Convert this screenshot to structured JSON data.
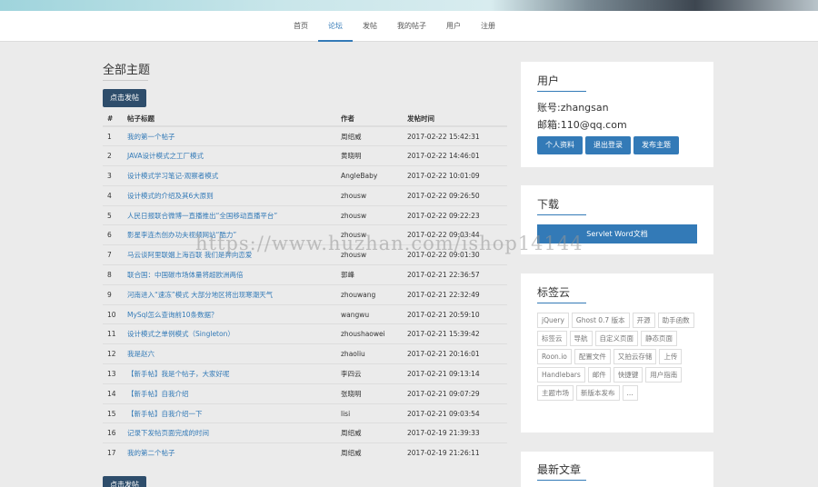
{
  "nav": {
    "items": [
      {
        "label": "首页"
      },
      {
        "label": "论坛"
      },
      {
        "label": "发帖"
      },
      {
        "label": "我的帖子"
      },
      {
        "label": "用户"
      },
      {
        "label": "注册"
      }
    ],
    "active": "论坛",
    "accent_color": "#337ab7"
  },
  "main": {
    "title": "全部主题",
    "post_button": "点击发帖",
    "columns": [
      "#",
      "帖子标题",
      "作者",
      "发帖时间"
    ],
    "rows": [
      {
        "num": "1",
        "title": "我的第一个帖子",
        "author": "周绍威",
        "time": "2017-02-22 15:42:31"
      },
      {
        "num": "2",
        "title": "JAVA设计模式之工厂模式",
        "author": "黄晓明",
        "time": "2017-02-22 14:46:01"
      },
      {
        "num": "3",
        "title": "设计模式学习笔记-观察者模式",
        "author": "AngleBaby",
        "time": "2017-02-22 10:01:09"
      },
      {
        "num": "4",
        "title": "设计模式的介绍及其6大原则",
        "author": "zhousw",
        "time": "2017-02-22 09:26:50"
      },
      {
        "num": "5",
        "title": "人民日报联合微博一直播推出“全国移动直播平台”",
        "author": "zhousw",
        "time": "2017-02-22 09:22:23"
      },
      {
        "num": "6",
        "title": "影星李连杰创办功夫视频网站“酷力”",
        "author": "zhousw",
        "time": "2017-02-22 09:03:44"
      },
      {
        "num": "7",
        "title": "马云谈阿里联姻上海百联 我们是奔向恋爱",
        "author": "zhousw",
        "time": "2017-02-22 09:01:30"
      },
      {
        "num": "8",
        "title": "联合国：中国碳市场体量将超欧洲两倍",
        "author": "郭峰",
        "time": "2017-02-21 22:36:57"
      },
      {
        "num": "9",
        "title": "河南进入“速冻”模式 大部分地区将出现寒潮天气",
        "author": "zhouwang",
        "time": "2017-02-21 22:32:49"
      },
      {
        "num": "10",
        "title": "MySql怎么查询前10条数据？",
        "author": "wangwu",
        "time": "2017-02-21 20:59:10"
      },
      {
        "num": "11",
        "title": "设计模式之单例模式（Singleton）",
        "author": "zhoushaowei",
        "time": "2017-02-21 15:39:42"
      },
      {
        "num": "12",
        "title": "我是赵六",
        "author": "zhaoliu",
        "time": "2017-02-21 20:16:01"
      },
      {
        "num": "13",
        "title": "【新手帖】我是个帖子，大家好呢",
        "author": "李四云",
        "time": "2017-02-21 09:13:14"
      },
      {
        "num": "14",
        "title": "【新手帖】自我介绍",
        "author": "张晓明",
        "time": "2017-02-21 09:07:29"
      },
      {
        "num": "15",
        "title": "【新手帖】自我介绍一下",
        "author": "lisi",
        "time": "2017-02-21 09:03:54"
      },
      {
        "num": "16",
        "title": "记录下发帖页面完成的时间",
        "author": "周绍威",
        "time": "2017-02-19 21:39:33"
      },
      {
        "num": "17",
        "title": "我的第二个帖子",
        "author": "周绍威",
        "time": "2017-02-19 21:26:11"
      }
    ]
  },
  "sidebar": {
    "user": {
      "title": "用户",
      "account": "账号:zhangsan",
      "email": "邮箱:110@qq.com",
      "buttons": [
        "个人资料",
        "退出登录",
        "发布主题"
      ]
    },
    "download": {
      "title": "下载",
      "button": "Servlet Word文档"
    },
    "tags": {
      "title": "标签云",
      "items": [
        "jQuery",
        "Ghost 0.7 版本",
        "开源",
        "助手函数",
        "标签云",
        "导航",
        "自定义页面",
        "静态页面",
        "Roon.io",
        "配置文件",
        "又拍云存储",
        "上传",
        "Handlebars",
        "邮件",
        "快捷键",
        "用户指南",
        "主题市场",
        "新版本发布",
        "..."
      ]
    },
    "latest": {
      "title": "最新文章"
    }
  },
  "watermark": "https://www.huzhan.com/ishop14144"
}
